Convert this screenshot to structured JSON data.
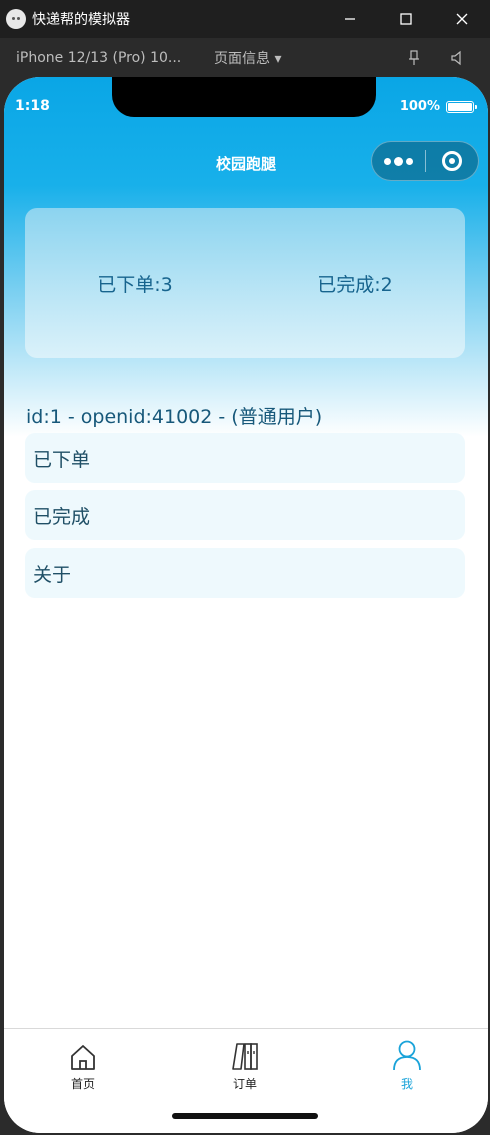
{
  "window": {
    "title": "快递帮的模拟器",
    "minimize_icon": "minimize-icon",
    "maximize_icon": "maximize-icon",
    "close_icon": "close-icon"
  },
  "toolbar": {
    "device": "iPhone 12/13 (Pro) 10...",
    "page_info": "页面信息 ▾"
  },
  "status_bar": {
    "time": "1:18",
    "battery": "100%"
  },
  "nav": {
    "title": "校园跑腿"
  },
  "stats": {
    "ordered": "已下单:3",
    "completed": "已完成:2"
  },
  "user": {
    "line": "id:1 - openid:41002 - (普通用户)"
  },
  "menu": [
    {
      "label": "已下单"
    },
    {
      "label": "已完成"
    },
    {
      "label": "关于"
    }
  ],
  "tabbar": {
    "items": [
      {
        "label": "首页",
        "icon": "home-icon"
      },
      {
        "label": "订单",
        "icon": "order-icon"
      },
      {
        "label": "我",
        "icon": "user-icon"
      }
    ],
    "active_color": "#1aa3d9"
  },
  "colors": {
    "accent": "#0aa6e6",
    "stat_text": "#17648e"
  }
}
